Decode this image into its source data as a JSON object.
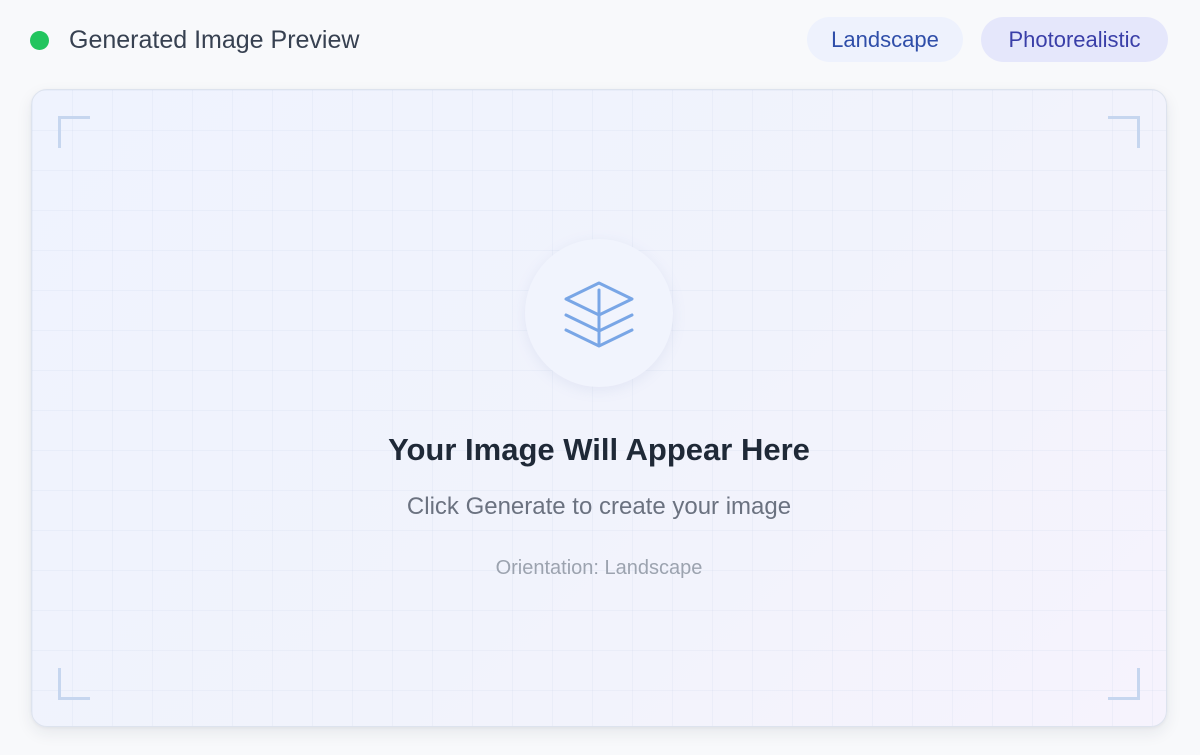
{
  "header": {
    "status_color": "#22c55e",
    "title": "Generated Image Preview",
    "chips": [
      "Landscape",
      "Photorealistic"
    ]
  },
  "preview": {
    "icon": "layers-icon",
    "headline": "Your Image Will Appear Here",
    "subtitle": "Click Generate to create your image",
    "orientation": "Orientation: Landscape"
  }
}
